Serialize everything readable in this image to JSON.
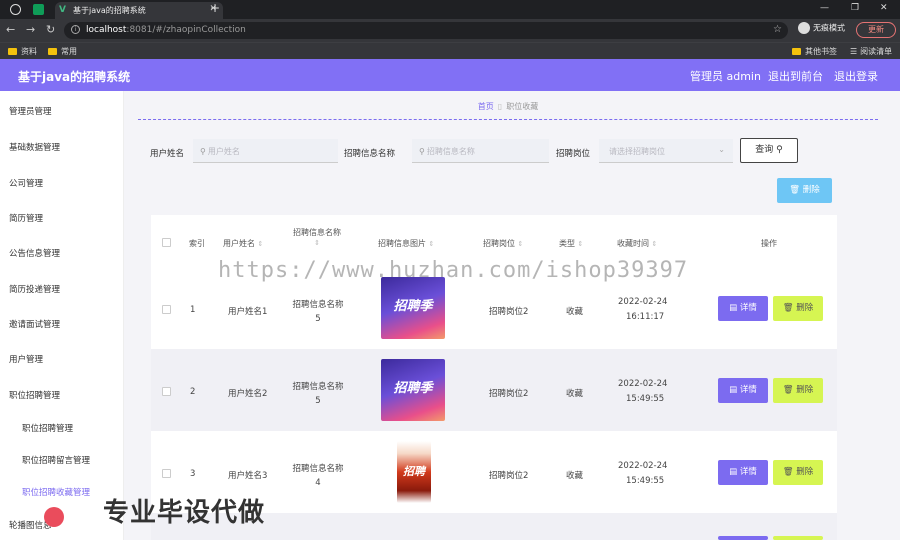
{
  "browser": {
    "tab_title": "基于java的招聘系统",
    "url_host": "localhost",
    "url_path": ":8081/#/zhaopinCollection",
    "incognito_label": "无痕模式",
    "update_label": "更新",
    "bookmarks": [
      "资料",
      "常用"
    ],
    "bookmarks_right": [
      "其他书签",
      "阅读清单"
    ]
  },
  "app": {
    "title": "基于java的招聘系统",
    "user_label": "管理员 admin",
    "frontend_link": "退出到前台",
    "logout_link": "退出登录"
  },
  "sidebar": {
    "items": [
      {
        "label": "管理员管理"
      },
      {
        "label": "基础数据管理"
      },
      {
        "label": "公司管理"
      },
      {
        "label": "简历管理"
      },
      {
        "label": "公告信息管理"
      },
      {
        "label": "简历投递管理"
      },
      {
        "label": "邀请面试管理"
      },
      {
        "label": "用户管理"
      },
      {
        "label": "职位招聘管理"
      },
      {
        "label": "职位招聘管理"
      },
      {
        "label": "职位招聘留言管理"
      },
      {
        "label": "职位招聘收藏管理"
      },
      {
        "label": "轮播图信息"
      }
    ]
  },
  "breadcrumb": {
    "home": "首页",
    "current": "职位收藏"
  },
  "filters": {
    "username_label": "用户姓名",
    "username_placeholder": "用户姓名",
    "jobname_label": "招聘信息名称",
    "jobname_placeholder": "招聘信息名称",
    "position_label": "招聘岗位",
    "position_placeholder": "请选择招聘岗位",
    "query_label": "查询"
  },
  "toolbar": {
    "delete_label": "删除"
  },
  "table": {
    "headers": {
      "index": "索引",
      "username": "用户姓名",
      "jobname": "招聘信息名称",
      "image": "招聘信息图片",
      "position": "招聘岗位",
      "type": "类型",
      "time": "收藏时间",
      "actions": "操作"
    },
    "rows": [
      {
        "index": "1",
        "username": "用户姓名1",
        "jobname": "招聘信息名称5",
        "position": "招聘岗位2",
        "type": "收藏",
        "date": "2022-02-24",
        "time": "16:11:17",
        "image_text": "招聘季"
      },
      {
        "index": "2",
        "username": "用户姓名2",
        "jobname": "招聘信息名称5",
        "position": "招聘岗位2",
        "type": "收藏",
        "date": "2022-02-24",
        "time": "15:49:55",
        "image_text": "招聘季"
      },
      {
        "index": "3",
        "username": "用户姓名3",
        "jobname": "招聘信息名称4",
        "position": "招聘岗位2",
        "type": "收藏",
        "date": "2022-02-24",
        "time": "15:49:55",
        "image_text": "招聘"
      }
    ],
    "detail_label": "详情",
    "delete_label": "删除"
  },
  "watermark": "https://www.huzhan.com/ishop39397",
  "overlay_text": "专业毕设代做",
  "colors": {
    "accent": "#8170f5",
    "detail": "#7c6bf0",
    "delete": "#d6f552",
    "top_delete": "#6ec6f5"
  }
}
